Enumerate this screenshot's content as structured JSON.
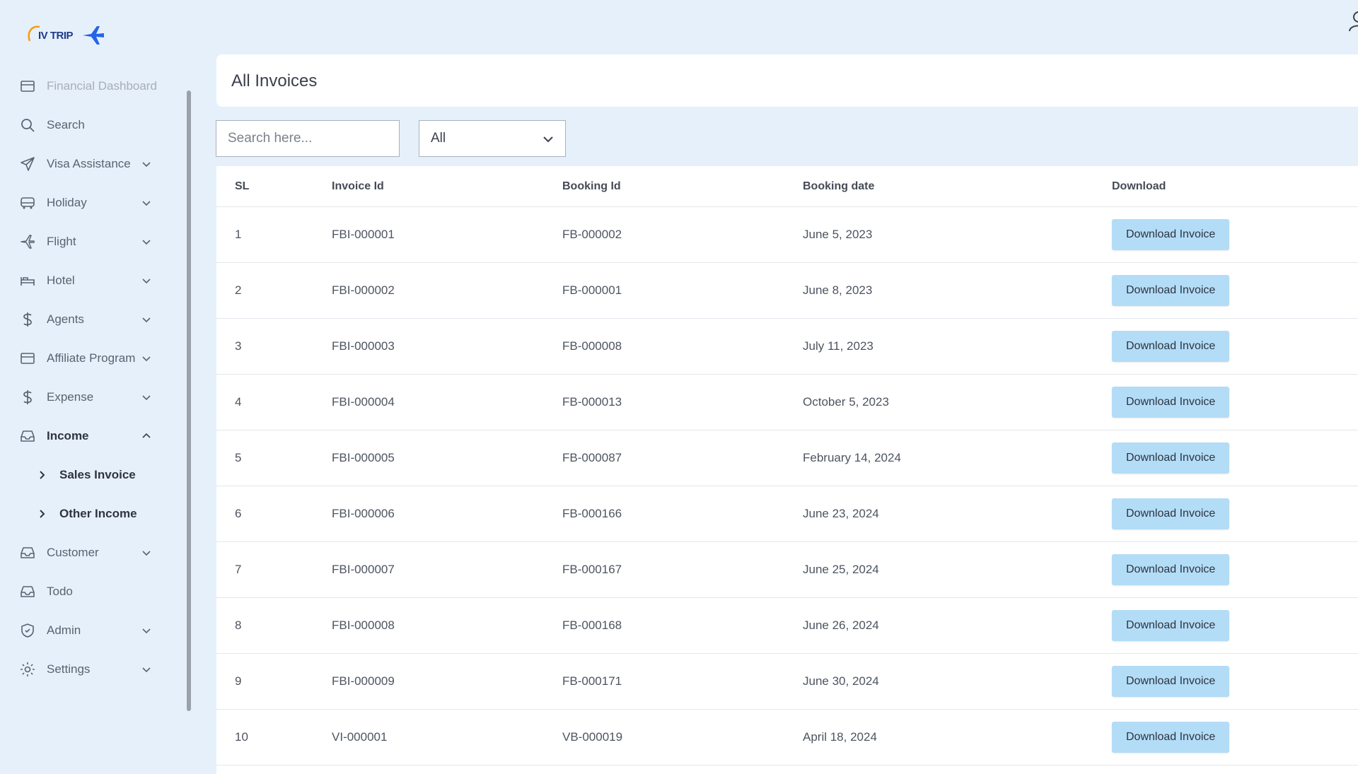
{
  "brand": {
    "logo_text": "IV TRIP"
  },
  "sidebar": {
    "items": [
      {
        "label": "Financial Dashboard",
        "icon": "card-icon",
        "chevron": false,
        "faded": true
      },
      {
        "label": "Search",
        "icon": "search-icon",
        "chevron": false
      },
      {
        "label": "Visa Assistance",
        "icon": "send-icon",
        "chevron": true
      },
      {
        "label": "Holiday",
        "icon": "bus-icon",
        "chevron": true
      },
      {
        "label": "Flight",
        "icon": "plane-icon",
        "chevron": true
      },
      {
        "label": "Hotel",
        "icon": "bed-icon",
        "chevron": true
      },
      {
        "label": "Agents",
        "icon": "dollar-icon",
        "chevron": true
      },
      {
        "label": "Affiliate Program",
        "icon": "card-icon",
        "chevron": true
      },
      {
        "label": "Expense",
        "icon": "dollar-icon",
        "chevron": true
      },
      {
        "label": "Income",
        "icon": "inbox-icon",
        "chevron": true,
        "expanded": true
      }
    ],
    "income_sub": [
      {
        "label": "Sales Invoice"
      },
      {
        "label": "Other Income"
      }
    ],
    "items_after": [
      {
        "label": "Customer",
        "icon": "inbox-icon",
        "chevron": true
      },
      {
        "label": "Todo",
        "icon": "inbox-icon",
        "chevron": false
      },
      {
        "label": "Admin",
        "icon": "shield-icon",
        "chevron": true
      },
      {
        "label": "Settings",
        "icon": "gear-icon",
        "chevron": true
      }
    ]
  },
  "page": {
    "title": "All Invoices"
  },
  "filters": {
    "search_placeholder": "Search here...",
    "select_value": "All"
  },
  "table": {
    "headers": [
      "SL",
      "Invoice Id",
      "Booking Id",
      "Booking date",
      "Download"
    ],
    "button_label": "Download Invoice",
    "rows": [
      {
        "sl": "1",
        "invoice": "FBI-000001",
        "booking": "FB-000002",
        "date": "June 5, 2023"
      },
      {
        "sl": "2",
        "invoice": "FBI-000002",
        "booking": "FB-000001",
        "date": "June 8, 2023"
      },
      {
        "sl": "3",
        "invoice": "FBI-000003",
        "booking": "FB-000008",
        "date": "July 11, 2023"
      },
      {
        "sl": "4",
        "invoice": "FBI-000004",
        "booking": "FB-000013",
        "date": "October 5, 2023"
      },
      {
        "sl": "5",
        "invoice": "FBI-000005",
        "booking": "FB-000087",
        "date": "February 14, 2024"
      },
      {
        "sl": "6",
        "invoice": "FBI-000006",
        "booking": "FB-000166",
        "date": "June 23, 2024"
      },
      {
        "sl": "7",
        "invoice": "FBI-000007",
        "booking": "FB-000167",
        "date": "June 25, 2024"
      },
      {
        "sl": "8",
        "invoice": "FBI-000008",
        "booking": "FB-000168",
        "date": "June 26, 2024"
      },
      {
        "sl": "9",
        "invoice": "FBI-000009",
        "booking": "FB-000171",
        "date": "June 30, 2024"
      },
      {
        "sl": "10",
        "invoice": "VI-000001",
        "booking": "VB-000019",
        "date": "April 18, 2024"
      }
    ]
  },
  "colors": {
    "accent": "#b3dcf7",
    "background": "#e6f0fa",
    "brand": "#1f3a8a"
  }
}
